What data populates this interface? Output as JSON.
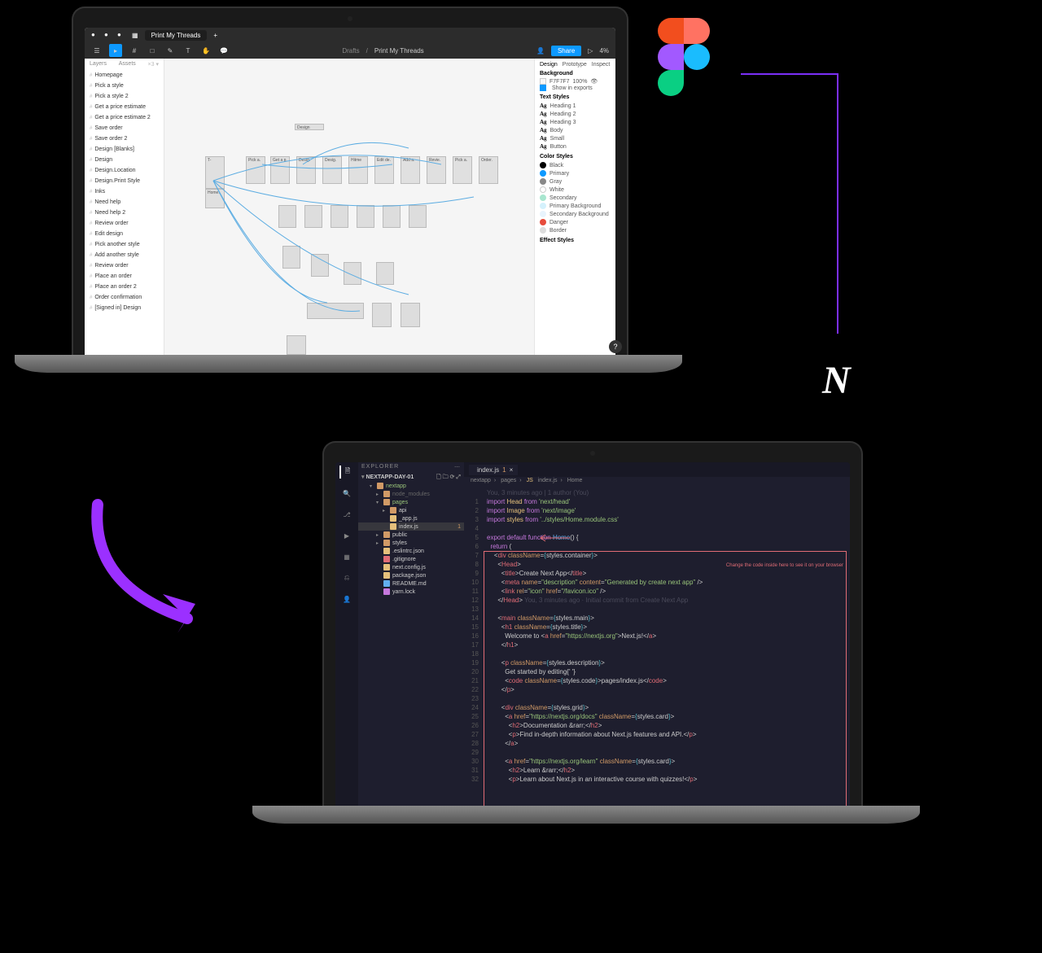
{
  "figma": {
    "tab_title": "Print My Threads",
    "breadcrumb_drafts": "Drafts",
    "breadcrumb_file": "Print My Threads",
    "share_label": "Share",
    "zoom": "4%",
    "left_panel": {
      "tabs": {
        "layers": "Layers",
        "assets": "Assets"
      },
      "frames": [
        "Homepage",
        "Pick a style",
        "Pick a style 2",
        "Get a price estimate",
        "Get a price estimate 2",
        "Save order",
        "Save order 2",
        "Design [Blanks]",
        "Design",
        "Design.Location",
        "Design.Print Style",
        "Inks",
        "Need help",
        "Need help 2",
        "Review order",
        "Edit design",
        "Pick another style",
        "Add another style",
        "Review order",
        "Place an order",
        "Place an order 2",
        "Order confirmation",
        "[Signed in] Design"
      ]
    },
    "right_panel": {
      "tabs": {
        "design": "Design",
        "prototype": "Prototype",
        "inspect": "Inspect"
      },
      "background": {
        "title": "Background",
        "hex": "F7F7F7",
        "opacity": "100%",
        "show_exports": "Show in exports"
      },
      "text_styles": {
        "title": "Text Styles",
        "items": [
          "Heading 1",
          "Heading 2",
          "Heading 3",
          "Body",
          "Small",
          "Button"
        ]
      },
      "color_styles": {
        "title": "Color Styles",
        "items": [
          {
            "name": "Black",
            "color": "#000000"
          },
          {
            "name": "Primary",
            "color": "#0d99ff"
          },
          {
            "name": "Gray",
            "color": "#888888"
          },
          {
            "name": "White",
            "color": "#ffffff"
          },
          {
            "name": "Secondary",
            "color": "#a8e6cf"
          },
          {
            "name": "Primary Background",
            "color": "#d4f1fc"
          },
          {
            "name": "Secondary Background",
            "color": "#e8f4fd"
          },
          {
            "name": "Danger",
            "color": "#e74c3c"
          },
          {
            "name": "Border",
            "color": "#dddddd"
          }
        ]
      },
      "effect_styles": {
        "title": "Effect Styles"
      }
    },
    "canvas_frames": [
      "Design",
      "T-",
      "Home.",
      "Pick a.",
      "Get a p.",
      "Desig.",
      "Desig.",
      "Hitme",
      "Edit de.",
      "Add a.",
      "Revie.",
      "Pick a.",
      "Order."
    ]
  },
  "vscode": {
    "explorer_title": "EXPLORER",
    "project": "NEXTAPP-DAY-01",
    "tree": [
      {
        "name": "nextapp",
        "type": "folder",
        "depth": 1,
        "open": true,
        "mod": "green"
      },
      {
        "name": "node_modules",
        "type": "folder",
        "depth": 2,
        "open": false,
        "dim": true
      },
      {
        "name": "pages",
        "type": "folder",
        "depth": 2,
        "open": true,
        "mod": "green"
      },
      {
        "name": "api",
        "type": "folder",
        "depth": 3,
        "open": false
      },
      {
        "name": "_app.js",
        "type": "js",
        "depth": 3
      },
      {
        "name": "index.js",
        "type": "js",
        "depth": 3,
        "sel": true,
        "badge": "1"
      },
      {
        "name": "public",
        "type": "folder",
        "depth": 2,
        "open": false
      },
      {
        "name": "styles",
        "type": "folder",
        "depth": 2,
        "open": false
      },
      {
        "name": ".eslintrc.json",
        "type": "json",
        "depth": 2
      },
      {
        "name": ".gitignore",
        "type": "git",
        "depth": 2
      },
      {
        "name": "next.config.js",
        "type": "js",
        "depth": 2
      },
      {
        "name": "package.json",
        "type": "json",
        "depth": 2
      },
      {
        "name": "README.md",
        "type": "md",
        "depth": 2
      },
      {
        "name": "yarn.lock",
        "type": "lock",
        "depth": 2
      }
    ],
    "tabs": [
      {
        "icon": "js",
        "name": "index.js",
        "mod": "1"
      }
    ],
    "breadcrumb": [
      "nextapp",
      "pages",
      "index.js",
      "Home"
    ],
    "blame": "You, 3 minutes ago | 1 author (You)",
    "annotation": "Change the code inside here to see it on your browser",
    "ghost_line": "You, 3 minutes ago · Initial commit from Create Next App",
    "code_lines": [
      {
        "n": 1,
        "html": "<span class='c-kw'>import</span> <span class='c-var'>Head</span> <span class='c-kw'>from</span> <span class='c-str'>'next/head'</span>"
      },
      {
        "n": 2,
        "html": "<span class='c-kw'>import</span> <span class='c-var'>Image</span> <span class='c-kw'>from</span> <span class='c-str'>'next/image'</span>"
      },
      {
        "n": 3,
        "html": "<span class='c-kw'>import</span> <span class='c-var'>styles</span> <span class='c-kw'>from</span> <span class='c-str'>'../styles/Home.module.css'</span>"
      },
      {
        "n": 4,
        "html": ""
      },
      {
        "n": 5,
        "html": "<span class='c-kw'>export default function</span> <span class='c-fn'>Home</span>() {"
      },
      {
        "n": 6,
        "html": "  <span class='c-kw'>return</span> ("
      },
      {
        "n": 7,
        "html": "    &lt;<span class='c-tag'>div</span> <span class='c-attr'>className</span>=<span class='c-op'>{</span>styles.container<span class='c-op'>}</span>&gt;"
      },
      {
        "n": 8,
        "html": "      &lt;<span class='c-tag'>Head</span>&gt;"
      },
      {
        "n": 9,
        "html": "        &lt;<span class='c-tag'>title</span>&gt;Create Next App&lt;/<span class='c-tag'>title</span>&gt;"
      },
      {
        "n": 10,
        "html": "        &lt;<span class='c-tag'>meta</span> <span class='c-attr'>name</span>=<span class='c-str'>\"description\"</span> <span class='c-attr'>content</span>=<span class='c-str'>\"Generated by create next app\"</span> /&gt;"
      },
      {
        "n": 11,
        "html": "        &lt;<span class='c-tag'>link</span> <span class='c-attr'>rel</span>=<span class='c-str'>\"icon\"</span> <span class='c-attr'>href</span>=<span class='c-str'>\"/favicon.ico\"</span> /&gt;"
      },
      {
        "n": 12,
        "html": "      &lt;/<span class='c-tag'>Head</span>&gt;"
      },
      {
        "n": 13,
        "html": ""
      },
      {
        "n": 14,
        "html": "      &lt;<span class='c-tag'>main</span> <span class='c-attr'>className</span>=<span class='c-op'>{</span>styles.main<span class='c-op'>}</span>&gt;"
      },
      {
        "n": 15,
        "html": "        &lt;<span class='c-tag'>h1</span> <span class='c-attr'>className</span>=<span class='c-op'>{</span>styles.title<span class='c-op'>}</span>&gt;"
      },
      {
        "n": 16,
        "html": "          Welcome to &lt;<span class='c-tag'>a</span> <span class='c-attr'>href</span>=<span class='c-str'>\"https://nextjs.org\"</span>&gt;Next.js!&lt;/<span class='c-tag'>a</span>&gt;"
      },
      {
        "n": 17,
        "html": "        &lt;/<span class='c-tag'>h1</span>&gt;"
      },
      {
        "n": 18,
        "html": ""
      },
      {
        "n": 19,
        "html": "        &lt;<span class='c-tag'>p</span> <span class='c-attr'>className</span>=<span class='c-op'>{</span>styles.description<span class='c-op'>}</span>&gt;"
      },
      {
        "n": 20,
        "html": "          Get started by editing{' '}"
      },
      {
        "n": 21,
        "html": "          &lt;<span class='c-tag'>code</span> <span class='c-attr'>className</span>=<span class='c-op'>{</span>styles.code<span class='c-op'>}</span>&gt;pages/index.js&lt;/<span class='c-tag'>code</span>&gt;"
      },
      {
        "n": 22,
        "html": "        &lt;/<span class='c-tag'>p</span>&gt;"
      },
      {
        "n": 23,
        "html": ""
      },
      {
        "n": 24,
        "html": "        &lt;<span class='c-tag'>div</span> <span class='c-attr'>className</span>=<span class='c-op'>{</span>styles.grid<span class='c-op'>}</span>&gt;"
      },
      {
        "n": 25,
        "html": "          &lt;<span class='c-tag'>a</span> <span class='c-attr'>href</span>=<span class='c-str'>\"https://nextjs.org/docs\"</span> <span class='c-attr'>className</span>=<span class='c-op'>{</span>styles.card<span class='c-op'>}</span>&gt;"
      },
      {
        "n": 26,
        "html": "            &lt;<span class='c-tag'>h2</span>&gt;Documentation &amp;rarr;&lt;/<span class='c-tag'>h2</span>&gt;"
      },
      {
        "n": 27,
        "html": "            &lt;<span class='c-tag'>p</span>&gt;Find in-depth information about Next.js features and API.&lt;/<span class='c-tag'>p</span>&gt;"
      },
      {
        "n": 28,
        "html": "          &lt;/<span class='c-tag'>a</span>&gt;"
      },
      {
        "n": 29,
        "html": ""
      },
      {
        "n": 30,
        "html": "          &lt;<span class='c-tag'>a</span> <span class='c-attr'>href</span>=<span class='c-str'>\"https://nextjs.org/learn\"</span> <span class='c-attr'>className</span>=<span class='c-op'>{</span>styles.card<span class='c-op'>}</span>&gt;"
      },
      {
        "n": 31,
        "html": "            &lt;<span class='c-tag'>h2</span>&gt;Learn &amp;rarr;&lt;/<span class='c-tag'>h2</span>&gt;"
      },
      {
        "n": 32,
        "html": "            &lt;<span class='c-tag'>p</span>&gt;Learn about Next.js in an interactive course with quizzes!&lt;/<span class='c-tag'>p</span>&gt;"
      }
    ]
  }
}
